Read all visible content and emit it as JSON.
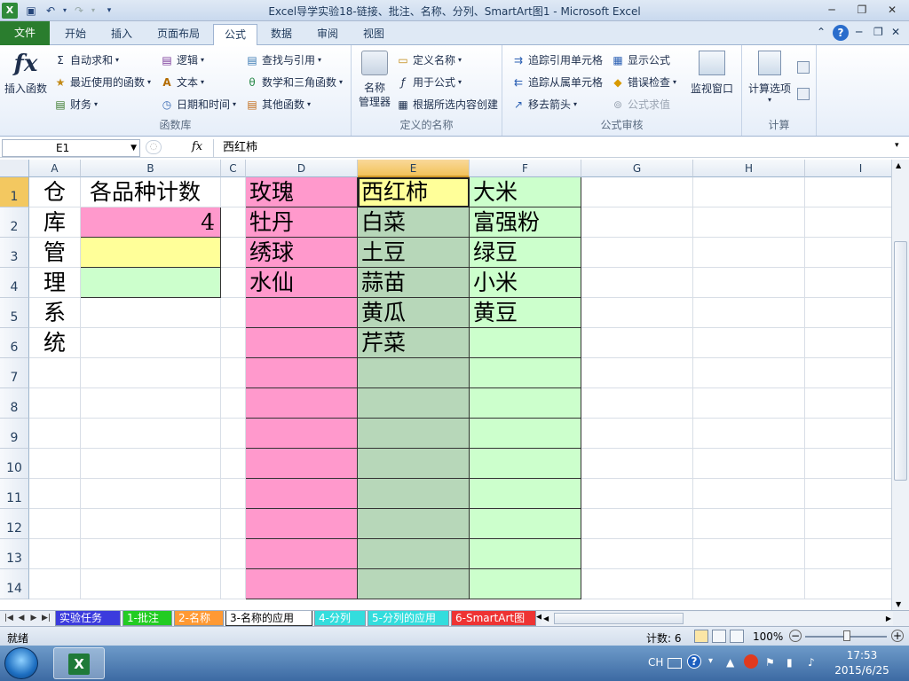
{
  "window": {
    "title": "Excel导学实验18-链接、批注、名称、分列、SmartArt图1 - Microsoft Excel"
  },
  "ribbon_tabs": [
    "文件",
    "开始",
    "插入",
    "页面布局",
    "公式",
    "数据",
    "审阅",
    "视图"
  ],
  "active_tab": "公式",
  "ribbon": {
    "insert_function": "插入函数",
    "function_library": {
      "autosum": "自动求和",
      "recent": "最近使用的函数",
      "financial": "财务",
      "logical": "逻辑",
      "text": "文本",
      "datetime": "日期和时间",
      "lookup": "查找与引用",
      "math": "数学和三角函数",
      "more": "其他函数",
      "group_label": "函数库"
    },
    "defined_names": {
      "name_manager": "名称\n管理器",
      "name_manager_l1": "名称",
      "name_manager_l2": "管理器",
      "define_name": "定义名称",
      "use_in_formula": "用于公式",
      "create_from_selection": "根据所选内容创建",
      "group_label": "定义的名称"
    },
    "formula_auditing": {
      "trace_precedents": "追踪引用单元格",
      "trace_dependents": "追踪从属单元格",
      "remove_arrows": "移去箭头",
      "show_formulas": "显示公式",
      "error_checking": "错误检查",
      "evaluate_formula": "公式求值",
      "watch_window": "监视窗口",
      "group_label": "公式审核"
    },
    "calculation": {
      "options": "计算选项",
      "group_label": "计算"
    }
  },
  "formula_bar": {
    "name_box": "E1",
    "fx": "fx",
    "content": "西红柿"
  },
  "columns": [
    "A",
    "B",
    "C",
    "D",
    "E",
    "F",
    "G",
    "H",
    "I"
  ],
  "rows": [
    "1",
    "2",
    "3",
    "4",
    "5",
    "6",
    "7",
    "8",
    "9",
    "10",
    "11",
    "12",
    "13",
    "14"
  ],
  "cells": {
    "A": [
      "仓",
      "库",
      "管",
      "理",
      "系",
      "统"
    ],
    "B1": "各品种计数",
    "B2": "4",
    "D": [
      "玫瑰",
      "牡丹",
      "绣球",
      "水仙"
    ],
    "E": [
      "西红柿",
      "白菜",
      "土豆",
      "蒜苗",
      "黄瓜",
      "芹菜"
    ],
    "F": [
      "大米",
      "富强粉",
      "绿豆",
      "小米",
      "黄豆"
    ]
  },
  "sheet_tabs": [
    {
      "label": "实验任务",
      "color": "#3b3bdd"
    },
    {
      "label": "1-批注",
      "color": "#22cc22"
    },
    {
      "label": "2-名称",
      "color": "#ff9933"
    },
    {
      "label": "3-名称的应用",
      "color": "#ffffff"
    },
    {
      "label": "4-分列",
      "color": "#33dddd"
    },
    {
      "label": "5-分列的应用",
      "color": "#33dddd"
    },
    {
      "label": "6-SmartArt图",
      "color": "#ee3333"
    }
  ],
  "active_sheet": "3-名称的应用",
  "status": {
    "ready": "就绪",
    "count": "计数: 6",
    "zoom": "100%"
  },
  "taskbar": {
    "lang": "CH",
    "time": "17:53",
    "date": "2015/6/25"
  }
}
